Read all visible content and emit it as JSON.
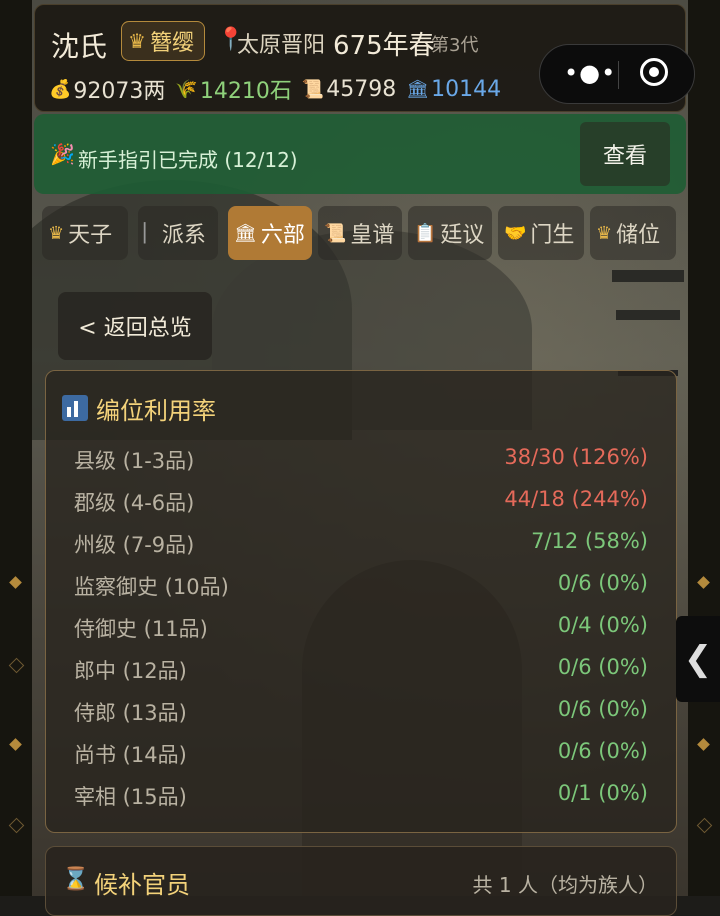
{
  "header": {
    "clan_name": "沈氏",
    "title_badge": "簪缨",
    "location": "太原晋阳",
    "year": "675年春",
    "generation": "第3代",
    "resources": [
      {
        "icon": "money-bag-icon",
        "value": "92073两",
        "color": "#e8e2d2"
      },
      {
        "icon": "grain-icon",
        "value": "14210石",
        "color": "#8fd17b"
      },
      {
        "icon": "scroll-icon",
        "value": "45798",
        "color": "#e8e2d2"
      },
      {
        "icon": "bank-icon",
        "value": "10144",
        "color": "#6aa8e8"
      }
    ]
  },
  "banner": {
    "icon": "party-popper-icon",
    "text": "新手指引已完成 (12/12)",
    "button": "查看"
  },
  "tabs": [
    {
      "label": "天子",
      "icon": "crown-icon"
    },
    {
      "label": "派系",
      "icon": "flag-icon"
    },
    {
      "label": "六部",
      "icon": "bank-icon",
      "active": true
    },
    {
      "label": "皇谱",
      "icon": "scroll-icon"
    },
    {
      "label": "廷议",
      "icon": "clipboard-icon"
    },
    {
      "label": "门生",
      "icon": "handshake-icon"
    },
    {
      "label": "储位",
      "icon": "crown-icon"
    }
  ],
  "back_button": "< 返回总览",
  "utilization": {
    "title": "编位利用率",
    "rows": [
      {
        "label": "县级 (1-3品)",
        "value": "38/30 (126%)",
        "status": "over"
      },
      {
        "label": "郡级 (4-6品)",
        "value": "44/18 (244%)",
        "status": "over"
      },
      {
        "label": "州级 (7-9品)",
        "value": "7/12 (58%)",
        "status": "ok"
      },
      {
        "label": "监察御史 (10品)",
        "value": "0/6 (0%)",
        "status": "ok"
      },
      {
        "label": "侍御史 (11品)",
        "value": "0/4 (0%)",
        "status": "ok"
      },
      {
        "label": "郎中 (12品)",
        "value": "0/6 (0%)",
        "status": "ok"
      },
      {
        "label": "侍郎 (13品)",
        "value": "0/6 (0%)",
        "status": "ok"
      },
      {
        "label": "尚书 (14品)",
        "value": "0/6 (0%)",
        "status": "ok"
      },
      {
        "label": "宰相 (15品)",
        "value": "0/1 (0%)",
        "status": "ok"
      }
    ]
  },
  "candidates": {
    "title": "候补官员",
    "count": "共 1 人（均为族人）"
  },
  "colors": {
    "accent_gold": "#f3d27a",
    "over": "#e56a5a",
    "ok": "#7cc77a",
    "active_tab": "#b07a35"
  }
}
